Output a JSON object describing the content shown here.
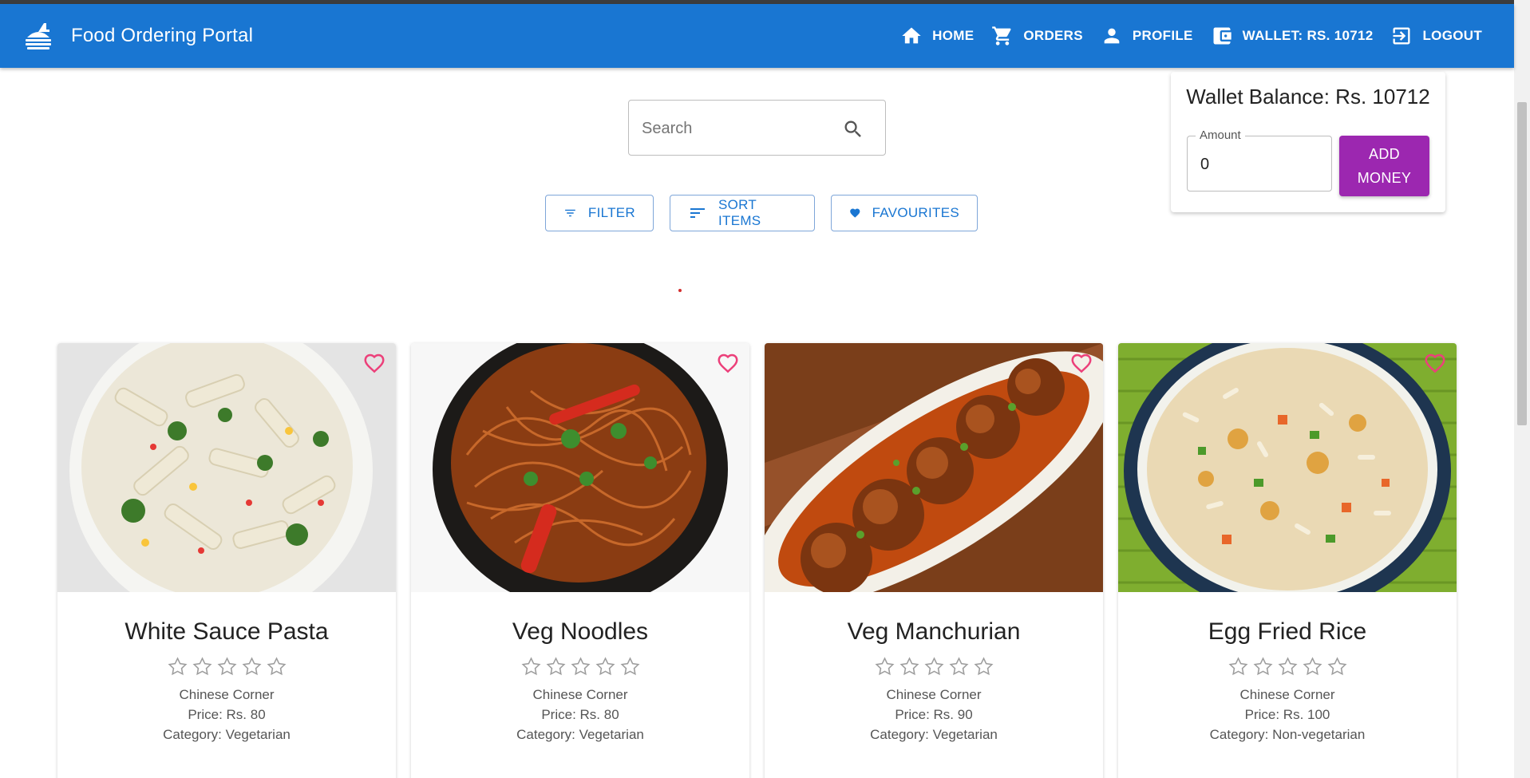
{
  "app": {
    "title": "Food Ordering Portal",
    "brand_icon": "fastfood-icon",
    "accent": "#1976d2"
  },
  "nav": [
    {
      "label": "HOME",
      "icon": "home-icon"
    },
    {
      "label": "ORDERS",
      "icon": "cart-icon"
    },
    {
      "label": "PROFILE",
      "icon": "person-icon"
    },
    {
      "label": "WALLET: RS. 10712",
      "icon": "wallet-icon"
    },
    {
      "label": "LOGOUT",
      "icon": "logout-icon"
    }
  ],
  "search": {
    "placeholder": "Search",
    "value": "",
    "icon": "search-icon"
  },
  "actions": {
    "filter": "FILTER",
    "sort": "SORT ITEMS",
    "favourites": "FAVOURITES"
  },
  "wallet": {
    "title": "Wallet Balance: Rs. 10712",
    "amount_label": "Amount",
    "amount_value": "0",
    "add_money_line1": "ADD",
    "add_money_line2": "MONEY",
    "button_color": "#9c27b0"
  },
  "items": [
    {
      "name": "White Sauce Pasta",
      "shop": "Chinese Corner",
      "price": "Price: Rs. 80",
      "category": "Category: Vegetarian",
      "rating": 0
    },
    {
      "name": "Veg Noodles",
      "shop": "Chinese Corner",
      "price": "Price: Rs. 80",
      "category": "Category: Vegetarian",
      "rating": 0
    },
    {
      "name": "Veg Manchurian",
      "shop": "Chinese Corner",
      "price": "Price: Rs. 90",
      "category": "Category: Vegetarian",
      "rating": 0
    },
    {
      "name": "Egg Fried Rice",
      "shop": "Chinese Corner",
      "price": "Price: Rs. 100",
      "category": "Category: Non-vegetarian",
      "rating": 0
    }
  ]
}
